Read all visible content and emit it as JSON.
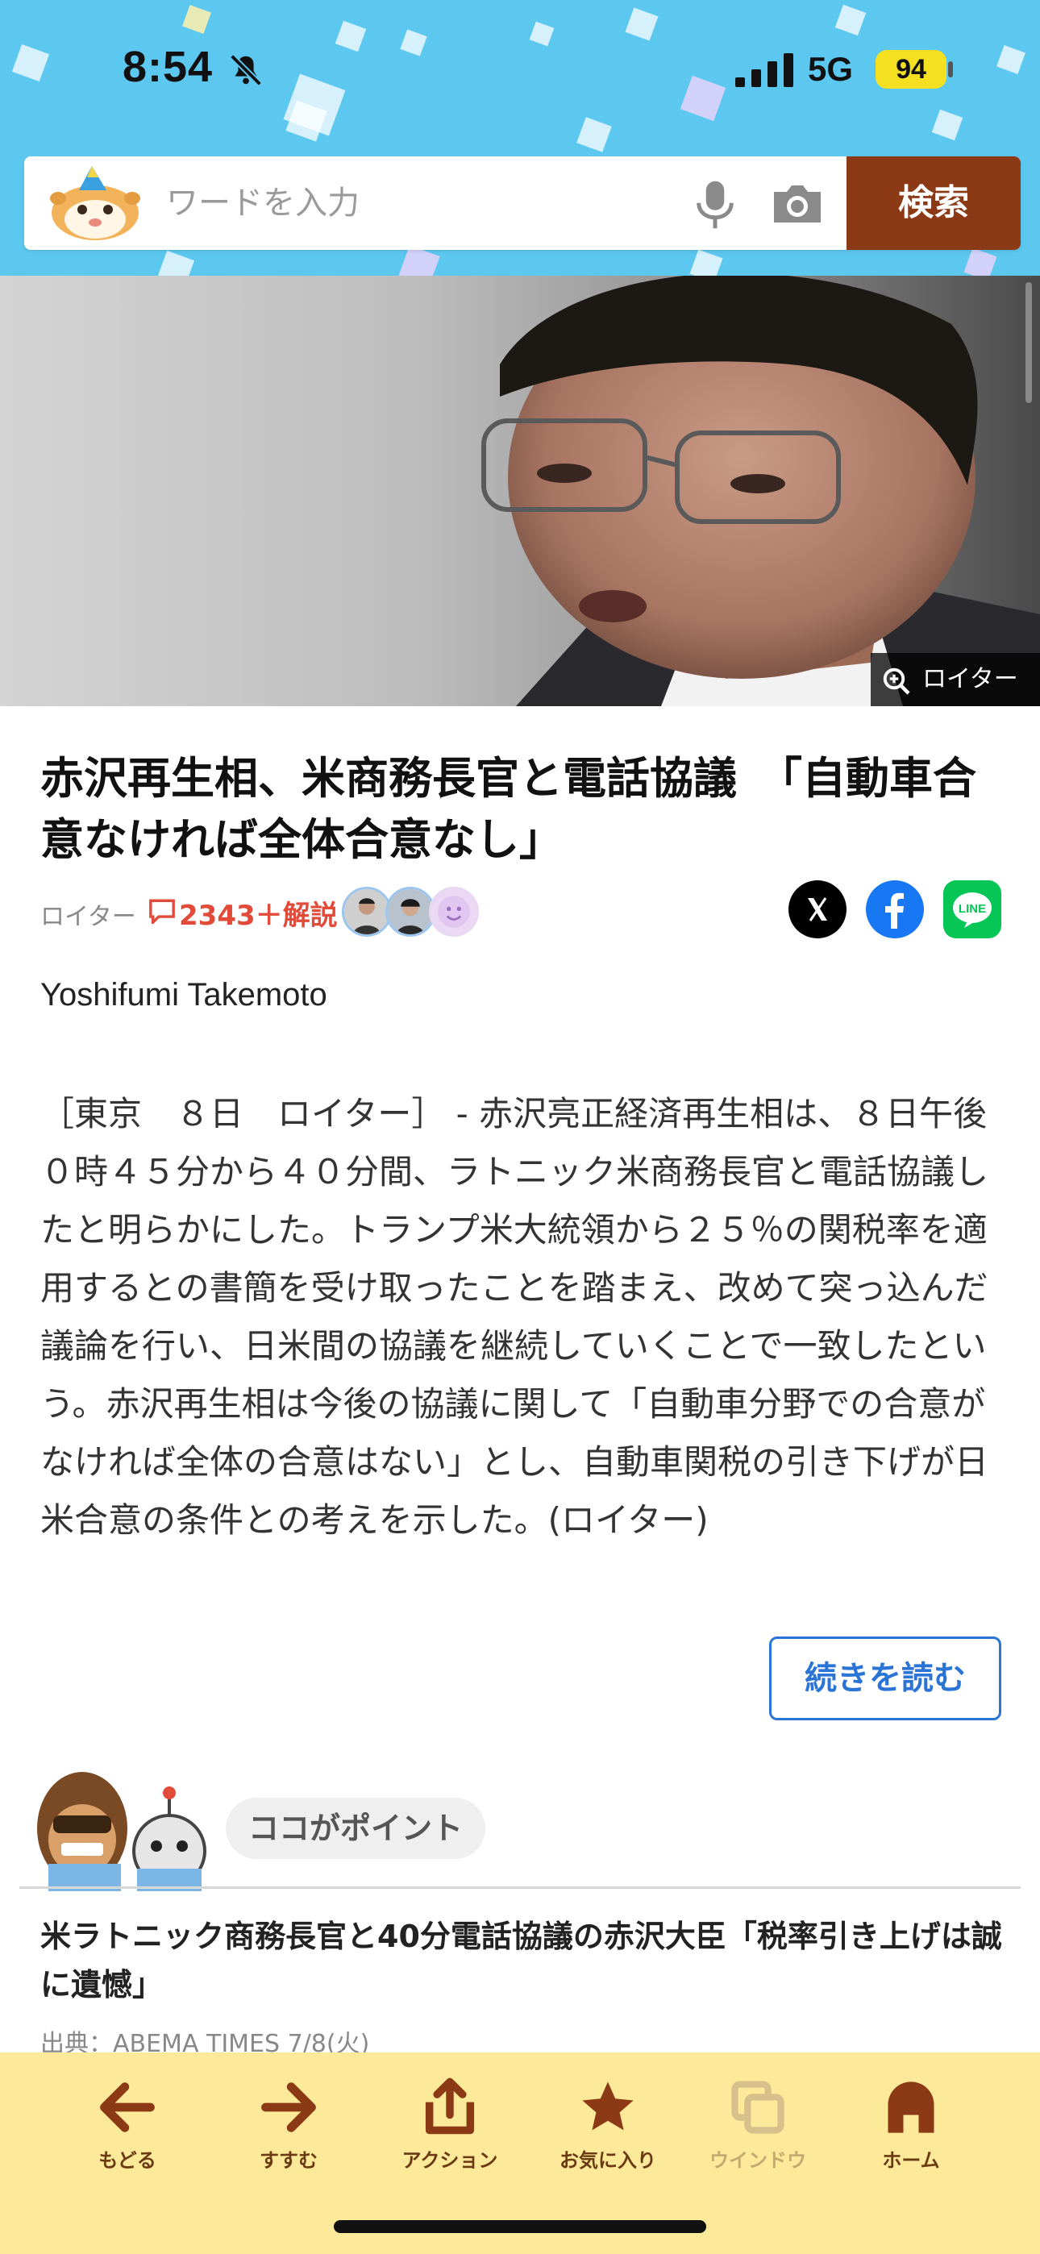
{
  "status_bar": {
    "time": "8:54",
    "network": "5G",
    "battery": "94"
  },
  "search": {
    "placeholder": "ワードを入力",
    "button_label": "検索"
  },
  "hero": {
    "credit": "ロイター"
  },
  "article": {
    "title": "赤沢再生相、米商務長官と電話協議　「自動車合意なければ全体合意なし」",
    "source": "ロイター",
    "comments": "2343＋解説",
    "byline": "Yoshifumi Takemoto",
    "body": "［東京　８日　ロイター］ - 赤沢亮正経済再生相は、８日午後０時４５分から４０分間、ラトニック米商務長官と電話協議したと明らかにした。トランプ米大統領から２５％の関税率を適用するとの書簡を受け取ったことを踏まえ、改めて突っ込んだ議論を行い、日米間の協議を継続していくことで一致したという。赤沢再生相は今後の協議に関して「自動車分野での合意がなければ全体の合意はない」とし、自動車関税の引き下げが日米合意の条件との考えを示した。(ロイター)",
    "read_more": "続きを読む"
  },
  "point": {
    "label": "ココがポイント",
    "related_title": "米ラトニック商務長官と40分電話協議の赤沢大臣「税率引き上げは誠に遺憾」",
    "related_source": "出典：ABEMA TIMES  7/8(火)"
  },
  "toolbar": {
    "back": "もどる",
    "forward": "すすむ",
    "action": "アクション",
    "favorite": "お気に入り",
    "window": "ウインドウ",
    "home": "ホーム"
  },
  "colors": {
    "header_sky": "#5cc8f0",
    "search_button": "#8c3a16",
    "comment_red": "#e24a3a",
    "link_blue": "#2a74d6",
    "toolbar_bg": "#fde99a",
    "toolbar_icon": "#8c3a16",
    "battery": "#f4e020"
  },
  "icons": [
    "bell-slash",
    "cellular-signal",
    "microphone",
    "camera",
    "zoom-in",
    "comment",
    "x-logo",
    "facebook-logo",
    "line-logo",
    "arrow-left",
    "arrow-right",
    "share",
    "star",
    "windows",
    "house"
  ]
}
